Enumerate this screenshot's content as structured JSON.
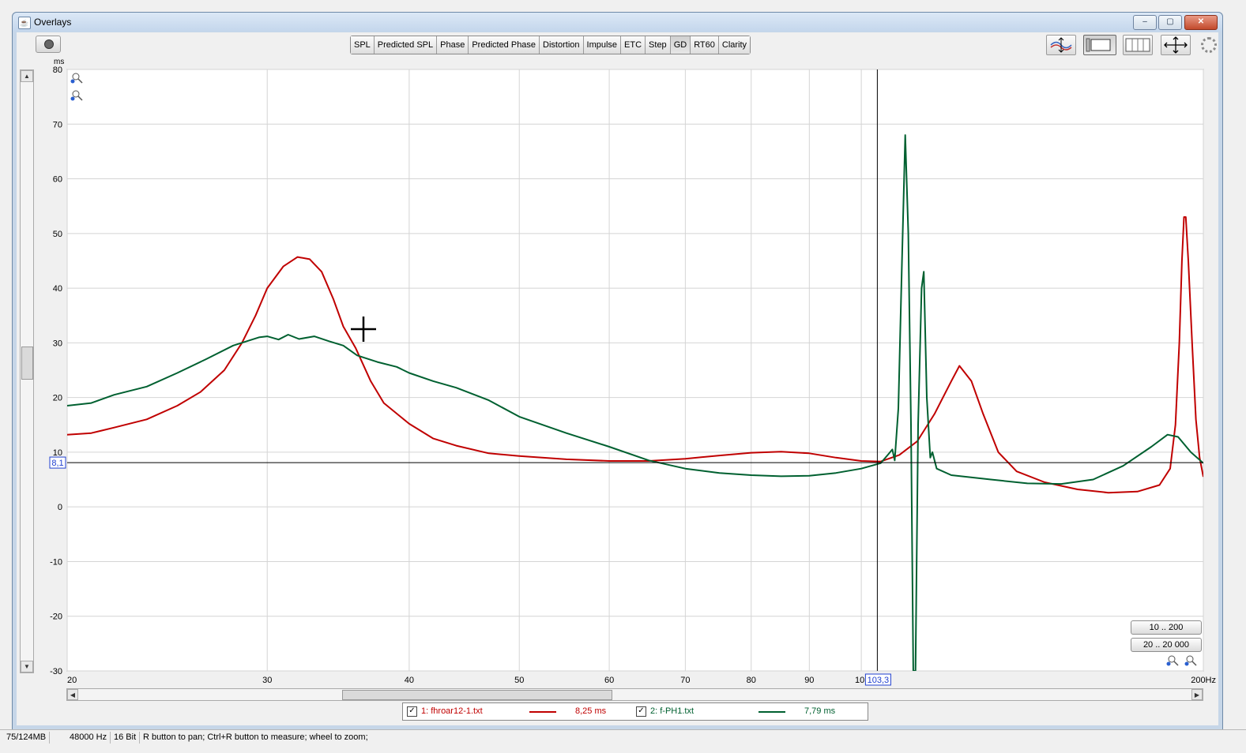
{
  "window": {
    "title": "Overlays",
    "min_label": "‒",
    "max_label": "▢",
    "close_label": "✕"
  },
  "tabs": [
    {
      "label": "SPL",
      "active": false
    },
    {
      "label": "Predicted SPL",
      "active": false
    },
    {
      "label": "Phase",
      "active": false
    },
    {
      "label": "Predicted Phase",
      "active": false
    },
    {
      "label": "Distortion",
      "active": false
    },
    {
      "label": "Impulse",
      "active": false
    },
    {
      "label": "ETC",
      "active": false
    },
    {
      "label": "Step",
      "active": false
    },
    {
      "label": "GD",
      "active": true
    },
    {
      "label": "RT60",
      "active": false
    },
    {
      "label": "Clarity",
      "active": false
    }
  ],
  "toolbar_icons": [
    "trace-arrange-icon",
    "graph-layout-icon",
    "vertical-lines-icon",
    "move-axes-icon",
    "gear-icon"
  ],
  "range_buttons": {
    "short": "10 .. 200",
    "full": "20 .. 20 000"
  },
  "cursor": {
    "x_label": "103,3",
    "y_label": "8,1",
    "x": 103.3,
    "y": 8.1
  },
  "legend": [
    {
      "check": "✓",
      "name": "1: fhroar12-1.txt",
      "value": "8,25 ms",
      "color": "#c00000"
    },
    {
      "check": "✓",
      "name": "2: f-PH1.txt",
      "value": "7,79 ms",
      "color": "#006030"
    }
  ],
  "status": {
    "memory": "75/124MB",
    "rate": "48000 Hz",
    "bits": "16 Bit",
    "hint": "R button to pan; Ctrl+R button to measure; wheel to zoom;"
  },
  "chart_data": {
    "type": "line",
    "ylabel": "ms",
    "xscale": "log",
    "xlim": [
      20,
      200
    ],
    "ylim": [
      -30,
      80
    ],
    "grid": true,
    "x_ticks": [
      {
        "v": 20,
        "label": "20"
      },
      {
        "v": 30,
        "label": "30"
      },
      {
        "v": 40,
        "label": "40"
      },
      {
        "v": 50,
        "label": "50"
      },
      {
        "v": 60,
        "label": "60"
      },
      {
        "v": 70,
        "label": "70"
      },
      {
        "v": 80,
        "label": "80"
      },
      {
        "v": 90,
        "label": "90"
      },
      {
        "v": 100,
        "label": "10"
      },
      {
        "v": 200,
        "label": "200Hz"
      }
    ],
    "y_ticks": [
      80,
      70,
      60,
      50,
      40,
      30,
      20,
      10,
      0,
      -10,
      -20,
      -30
    ],
    "series": [
      {
        "name": "1: fhroar12-1.txt",
        "color": "#c00000",
        "points": [
          [
            20,
            13.2
          ],
          [
            21,
            13.5
          ],
          [
            22,
            14.5
          ],
          [
            23.5,
            16
          ],
          [
            25,
            18.5
          ],
          [
            26.2,
            21
          ],
          [
            27.5,
            25
          ],
          [
            28.5,
            30
          ],
          [
            29.3,
            35
          ],
          [
            30,
            40
          ],
          [
            31,
            44
          ],
          [
            31.9,
            45.7
          ],
          [
            32.7,
            45.3
          ],
          [
            33.5,
            43
          ],
          [
            34.3,
            38
          ],
          [
            35,
            33
          ],
          [
            35.9,
            29
          ],
          [
            37,
            23
          ],
          [
            38,
            19
          ],
          [
            40,
            15.2
          ],
          [
            42,
            12.5
          ],
          [
            44,
            11.2
          ],
          [
            47,
            9.8
          ],
          [
            50,
            9.3
          ],
          [
            55,
            8.7
          ],
          [
            60,
            8.4
          ],
          [
            65,
            8.4
          ],
          [
            70,
            8.8
          ],
          [
            75,
            9.4
          ],
          [
            80,
            9.9
          ],
          [
            85,
            10.1
          ],
          [
            90,
            9.8
          ],
          [
            95,
            9
          ],
          [
            100,
            8.4
          ],
          [
            104,
            8.3
          ],
          [
            108,
            9.5
          ],
          [
            112,
            12
          ],
          [
            116,
            17
          ],
          [
            120,
            23
          ],
          [
            122,
            25.8
          ],
          [
            125,
            23
          ],
          [
            128,
            17
          ],
          [
            132,
            10
          ],
          [
            137,
            6.5
          ],
          [
            145,
            4.5
          ],
          [
            155,
            3.2
          ],
          [
            165,
            2.6
          ],
          [
            175,
            2.8
          ],
          [
            183,
            4
          ],
          [
            187,
            7
          ],
          [
            189,
            15
          ],
          [
            190.5,
            30
          ],
          [
            191.5,
            45
          ],
          [
            192.3,
            53
          ],
          [
            193,
            53
          ],
          [
            194,
            45
          ],
          [
            195.5,
            30
          ],
          [
            197,
            16
          ],
          [
            198.5,
            9
          ],
          [
            200,
            5.5
          ]
        ]
      },
      {
        "name": "2: f-PH1.txt",
        "color": "#006030",
        "points": [
          [
            20,
            18.5
          ],
          [
            21,
            19
          ],
          [
            22,
            20.5
          ],
          [
            23.5,
            22
          ],
          [
            25,
            24.5
          ],
          [
            26.5,
            27
          ],
          [
            28,
            29.5
          ],
          [
            29.5,
            31
          ],
          [
            30,
            31.2
          ],
          [
            30.7,
            30.6
          ],
          [
            31.3,
            31.5
          ],
          [
            32,
            30.7
          ],
          [
            33,
            31.2
          ],
          [
            34,
            30.3
          ],
          [
            35,
            29.5
          ],
          [
            36,
            27.7
          ],
          [
            37.5,
            26.5
          ],
          [
            39,
            25.6
          ],
          [
            40,
            24.5
          ],
          [
            42,
            23
          ],
          [
            44,
            21.8
          ],
          [
            47,
            19.5
          ],
          [
            50,
            16.5
          ],
          [
            55,
            13.5
          ],
          [
            60,
            11
          ],
          [
            65,
            8.5
          ],
          [
            70,
            7
          ],
          [
            75,
            6.2
          ],
          [
            80,
            5.8
          ],
          [
            85,
            5.6
          ],
          [
            90,
            5.7
          ],
          [
            95,
            6.2
          ],
          [
            100,
            7
          ],
          [
            104,
            8
          ],
          [
            105.5,
            9.5
          ],
          [
            106.5,
            10.5
          ],
          [
            107,
            8.5
          ],
          [
            107.8,
            18
          ],
          [
            108.6,
            45
          ],
          [
            109.3,
            68
          ],
          [
            110,
            50
          ],
          [
            110.6,
            15
          ],
          [
            111.1,
            -30
          ],
          [
            111.6,
            -30
          ],
          [
            112.2,
            15
          ],
          [
            113,
            40
          ],
          [
            113.5,
            43
          ],
          [
            114.2,
            20
          ],
          [
            115,
            9
          ],
          [
            115.5,
            10
          ],
          [
            116.5,
            7
          ],
          [
            120,
            5.8
          ],
          [
            130,
            5
          ],
          [
            140,
            4.3
          ],
          [
            150,
            4.2
          ],
          [
            160,
            5
          ],
          [
            170,
            7.5
          ],
          [
            180,
            11
          ],
          [
            186,
            13.2
          ],
          [
            190,
            12.8
          ],
          [
            195,
            10
          ],
          [
            200,
            8
          ]
        ]
      }
    ]
  }
}
